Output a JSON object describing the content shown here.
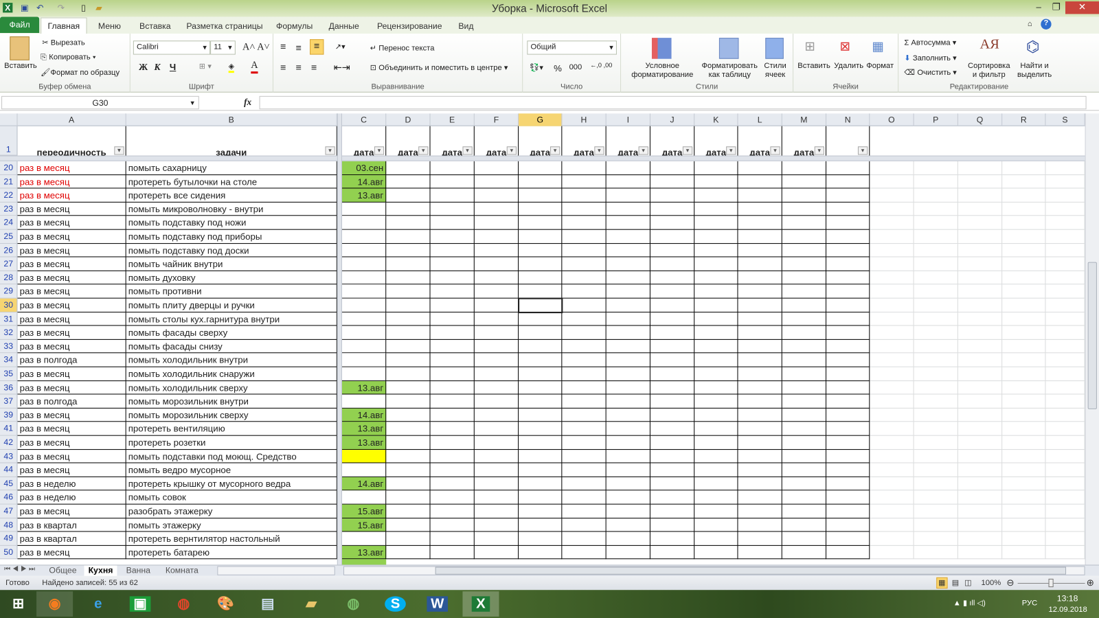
{
  "window": {
    "title": "Уборка  -  Microsoft Excel"
  },
  "ribbon_tabs": [
    "Файл",
    "Главная",
    "Меню",
    "Вставка",
    "Разметка страницы",
    "Формулы",
    "Данные",
    "Рецензирование",
    "Вид"
  ],
  "clipboard": {
    "paste": "Вставить",
    "cut": "Вырезать",
    "copy": "Копировать",
    "format_painter": "Формат по образцу",
    "label": "Буфер обмена"
  },
  "font": {
    "name": "Calibri",
    "size": "11",
    "bold": "Ж",
    "italic": "К",
    "underline": "Ч",
    "label": "Шрифт"
  },
  "alignment": {
    "wrap": "Перенос текста",
    "merge": "Объединить и поместить в центре",
    "label": "Выравнивание"
  },
  "number": {
    "format": "Общий",
    "percent": "%",
    "thousands": "000",
    "label": "Число"
  },
  "styles": {
    "conditional": "Условное форматирование",
    "as_table": "Форматировать как таблицу",
    "cell_styles": "Стили ячеек",
    "label": "Стили"
  },
  "cells": {
    "insert": "Вставить",
    "delete": "Удалить",
    "format": "Формат",
    "label": "Ячейки"
  },
  "editing": {
    "autosum": "Автосумма",
    "fill": "Заполнить",
    "clear": "Очистить",
    "sort": "Сортировка и фильтр",
    "find": "Найти и выделить",
    "label": "Редактирование"
  },
  "formula_bar": {
    "name_box": "G30",
    "fx": "fx",
    "value": ""
  },
  "columns": [
    "A",
    "B",
    "C",
    "D",
    "E",
    "F",
    "G",
    "H",
    "I",
    "J",
    "K",
    "L",
    "M",
    "N",
    "O",
    "P",
    "Q",
    "R",
    "S"
  ],
  "selected_column": "G",
  "header_row": {
    "num": "1",
    "a": "переодичность",
    "b": "задачи",
    "date": "дата"
  },
  "rows": [
    {
      "n": "20",
      "a": "раз в месяц",
      "b": "помыть сахарницу",
      "c": "03.сен",
      "red": true
    },
    {
      "n": "21",
      "a": "раз в месяц",
      "b": "протереть бутылочки на столе",
      "c": "14.авг",
      "red": true
    },
    {
      "n": "22",
      "a": "раз в месяц",
      "b": "протереть все сидения",
      "c": "13.авг",
      "red": true
    },
    {
      "n": "23",
      "a": "раз в месяц",
      "b": "помыть микроволновку - внутри",
      "c": ""
    },
    {
      "n": "24",
      "a": "раз в месяц",
      "b": "помыть подставку под ножи",
      "c": ""
    },
    {
      "n": "25",
      "a": "раз в месяц",
      "b": "помыть подставку под приборы",
      "c": ""
    },
    {
      "n": "26",
      "a": "раз в месяц",
      "b": "помыть подставку под доски",
      "c": ""
    },
    {
      "n": "27",
      "a": "раз в месяц",
      "b": "помыть чайник внутри",
      "c": ""
    },
    {
      "n": "28",
      "a": "раз в месяц",
      "b": "помыть духовку",
      "c": ""
    },
    {
      "n": "29",
      "a": "раз в месяц",
      "b": "помыть противни",
      "c": ""
    },
    {
      "n": "30",
      "a": "раз в месяц",
      "b": "помыть плиту дверцы и ручки",
      "c": ""
    },
    {
      "n": "31",
      "a": "раз в месяц",
      "b": "помыть столы кух.гарнитура внутри",
      "c": ""
    },
    {
      "n": "32",
      "a": "раз в месяц",
      "b": "помыть фасады сверху",
      "c": ""
    },
    {
      "n": "33",
      "a": "раз в месяц",
      "b": "помыть фасады снизу",
      "c": ""
    },
    {
      "n": "34",
      "a": "раз в полгода",
      "b": "помыть холодильник внутри",
      "c": ""
    },
    {
      "n": "35",
      "a": "раз в месяц",
      "b": "помыть холодильник снаружи",
      "c": ""
    },
    {
      "n": "36",
      "a": "раз в месяц",
      "b": "помыть холодильник сверху",
      "c": "13.авг"
    },
    {
      "n": "37",
      "a": "раз в полгода",
      "b": "помыть морозильник внутри",
      "c": ""
    },
    {
      "n": "39",
      "a": "раз в месяц",
      "b": "помыть морозильник сверху",
      "c": "14.авг"
    },
    {
      "n": "41",
      "a": "раз в месяц",
      "b": "протереть вентиляцию",
      "c": "13.авг"
    },
    {
      "n": "42",
      "a": "раз в месяц",
      "b": "протереть розетки",
      "c": "13.авг"
    },
    {
      "n": "43",
      "a": "раз в месяц",
      "b": "помыть подставки под моющ. Средство",
      "c": "",
      "yellow": true
    },
    {
      "n": "44",
      "a": "раз в месяц",
      "b": "помыть ведро мусорное",
      "c": ""
    },
    {
      "n": "45",
      "a": "раз в неделю",
      "b": "протереть крышку от мусорного ведра",
      "c": "14.авг"
    },
    {
      "n": "46",
      "a": "раз в неделю",
      "b": "помыть совок",
      "c": ""
    },
    {
      "n": "47",
      "a": "раз в месяц",
      "b": "разобрать этажерку",
      "c": "15.авг"
    },
    {
      "n": "48",
      "a": "раз в квартал",
      "b": "помыть этажерку",
      "c": "15.авг"
    },
    {
      "n": "49",
      "a": "раз в квартал",
      "b": "протереть вернтилятор настольный",
      "c": ""
    },
    {
      "n": "50",
      "a": "раз в месяц",
      "b": "протереть батарею",
      "c": "13.авг"
    }
  ],
  "sheets": [
    "Общее",
    "Кухня",
    "Ванна",
    "Комната"
  ],
  "active_sheet": "Кухня",
  "status": {
    "ready": "Готово",
    "found": "Найдено записей: 55 из 62",
    "zoom": "100%"
  },
  "taskbar": {
    "time": "13:18",
    "date": "12.09.2018",
    "lang": "РУС"
  },
  "colors": {
    "green_fill": "#92d050",
    "yellow_fill": "#ffff00",
    "red_text": "#e00000",
    "accent": "#217346"
  }
}
